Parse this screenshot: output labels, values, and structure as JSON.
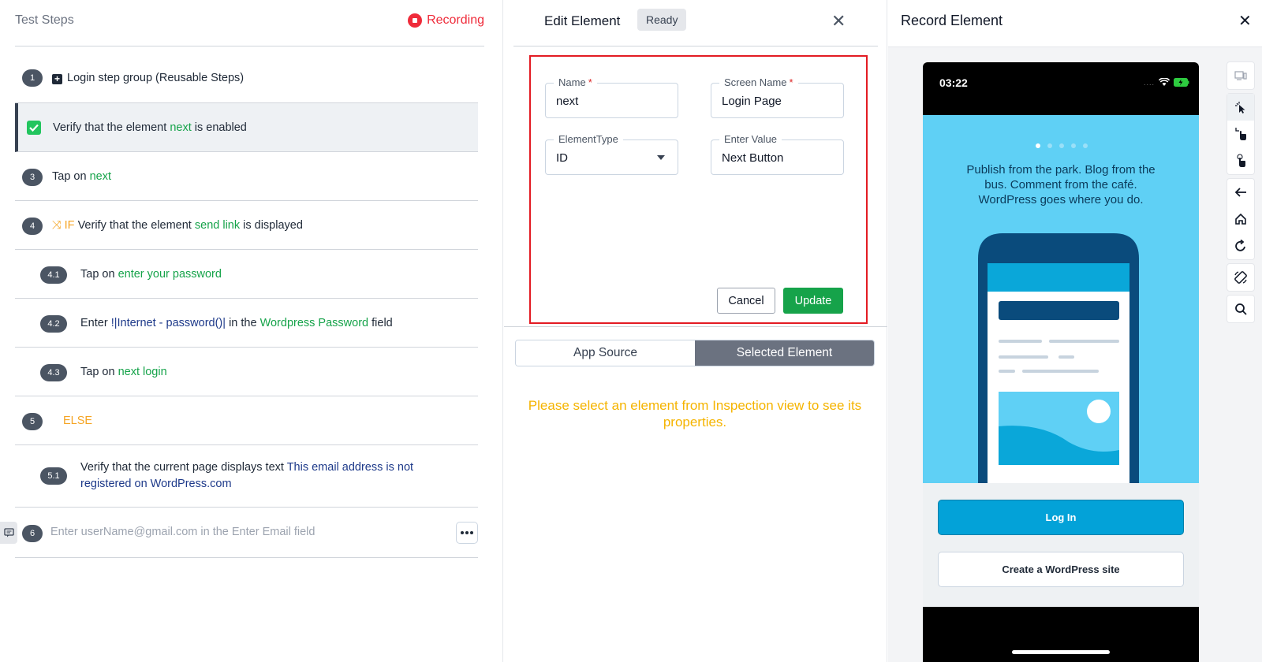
{
  "left": {
    "title": "Test Steps",
    "recording_label": "Recording",
    "steps": [
      {
        "num": "1",
        "prefix": "Login step group (Reusable Steps)"
      },
      {
        "text_a": "Verify that the element ",
        "el": "next",
        "text_b": " is enabled"
      },
      {
        "num": "3",
        "text_a": "Tap on ",
        "el": "next"
      },
      {
        "num": "4",
        "if_label": "IF",
        "text_a": "Verify that the element ",
        "el": "send link",
        "text_b": " is displayed"
      },
      {
        "num": "4.1",
        "text_a": "Tap on ",
        "el": "enter your password"
      },
      {
        "num": "4.2",
        "text_a": "Enter ",
        "value": "!|Internet - password()|",
        "text_b": " in the ",
        "el": "Wordpress Password",
        "text_c": " field"
      },
      {
        "num": "4.3",
        "text_a": "Tap on ",
        "el": "next login"
      },
      {
        "num": "5",
        "else_label": "ELSE"
      },
      {
        "num": "5.1",
        "text_a": "Verify that the current page displays text ",
        "value_line1": "This email address is not",
        "value_line2": "registered on WordPress.com"
      },
      {
        "num": "6",
        "placeholder": "Enter userName@gmail.com in the Enter Email field"
      }
    ]
  },
  "edit": {
    "title": "Edit Element",
    "status": "Ready",
    "name_label": "Name",
    "name_value": "next",
    "screen_label": "Screen Name",
    "screen_value": "Login Page",
    "type_label": "ElementType",
    "type_value": "ID",
    "enter_label": "Enter Value",
    "enter_value": "Next Button",
    "required_mark": "*",
    "cancel": "Cancel",
    "update": "Update",
    "tab_source": "App Source",
    "tab_selected": "Selected Element",
    "hint_line1": "Please select an element from Inspection view to see its",
    "hint_line2": "properties."
  },
  "record": {
    "title": "Record Element",
    "phone": {
      "time": "03:22",
      "copy_line1": "Publish from the park. Blog from the",
      "copy_line2": "bus. Comment from the café.",
      "copy_line3": "WordPress goes where you do.",
      "login": "Log In",
      "create": "Create a WordPress site"
    }
  },
  "colors": {
    "accent_green": "#16a34a",
    "recording_red": "#ef2b3a",
    "highlight_red": "#e31b23",
    "warning_yellow": "#f5b400",
    "wp_blue": "#03a2d8"
  }
}
